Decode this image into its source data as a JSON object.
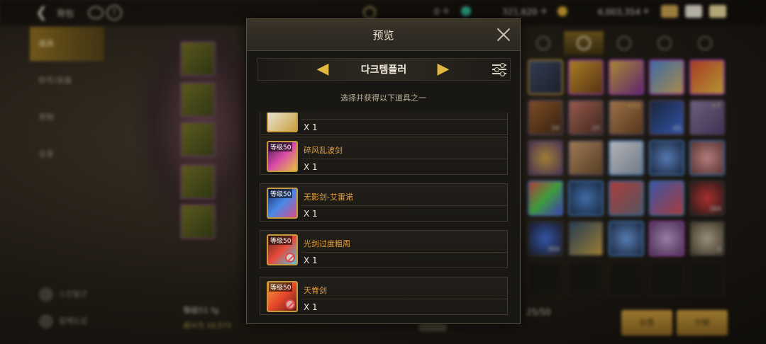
{
  "topbar": {
    "title": "背包",
    "currency1": "0",
    "currency2": "321,620",
    "currency3": "4,003,354",
    "colors": {
      "gem": "#2fbf9a",
      "gold": "#d8a430"
    }
  },
  "left_menu": {
    "items": [
      {
        "label": "道具",
        "active": true
      },
      {
        "label": "称号/装备"
      },
      {
        "label": "宠物"
      },
      {
        "label": "全身"
      }
    ],
    "bottom_buttons": [
      "스킨탈곤",
      "칼메도감"
    ]
  },
  "character": {
    "level_text": "等级51 fg",
    "stat_text": "战斗力 10,573"
  },
  "inventory": {
    "count": "25/50",
    "stack_counts": [
      "28",
      "25",
      "+12",
      "45",
      "+7",
      "384",
      "369",
      "8"
    ],
    "buttons": [
      "出售",
      "分解"
    ]
  },
  "modal": {
    "title": "预览",
    "selector_label": "다크템플러",
    "hint": "选择并获得以下道具之一",
    "items": [
      {
        "name": "",
        "qty": "X 1",
        "level": "",
        "locked": false
      },
      {
        "name": "碎风乱波剑",
        "qty": "X 1",
        "level": "等级50",
        "locked": false
      },
      {
        "name": "无影剑-艾雷诺",
        "qty": "X 1",
        "level": "等级50",
        "locked": false
      },
      {
        "name": "光剑过度粗周",
        "qty": "X 1",
        "level": "等级50",
        "locked": true
      },
      {
        "name": "天脊剑",
        "qty": "X 1",
        "level": "等级50",
        "locked": true
      }
    ]
  }
}
